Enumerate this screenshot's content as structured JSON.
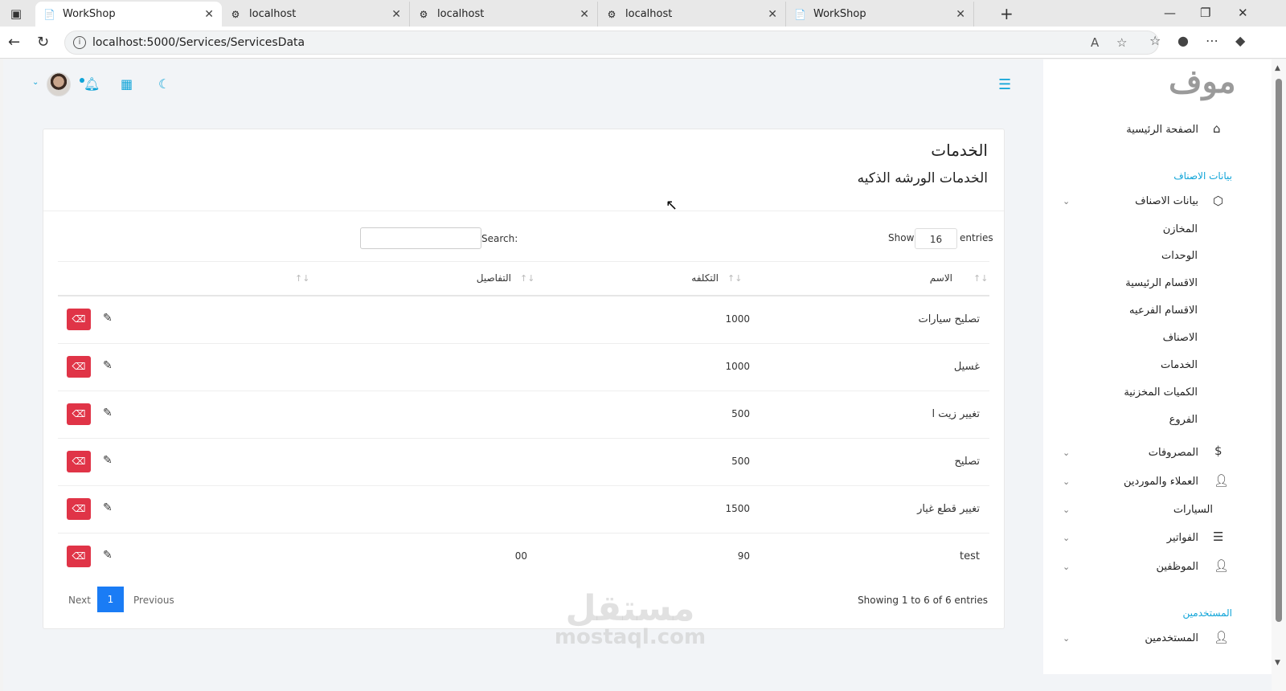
{
  "browser": {
    "tabs": [
      {
        "title": "WorkShop",
        "active": true
      },
      {
        "title": "localhost",
        "active": false
      },
      {
        "title": "localhost",
        "active": false
      },
      {
        "title": "localhost",
        "active": false
      },
      {
        "title": "WorkShop",
        "active": false
      }
    ],
    "url": "localhost:5000/Services/ServicesData"
  },
  "page": {
    "title": "الخدمات",
    "subtitle": "الخدمات الورشه الذكيه"
  },
  "table_controls": {
    "show_label": "Show",
    "entries_label": "entries",
    "page_length": "16",
    "search_label": "Search:"
  },
  "table": {
    "columns": [
      "الاسم",
      "التكلفه",
      "التفاصيل"
    ],
    "rows": [
      {
        "name": "تصليح سيارات",
        "cost": "1000",
        "details": ""
      },
      {
        "name": "غسيل",
        "cost": "1000",
        "details": ""
      },
      {
        "name": "تغيير زيت ا",
        "cost": "500",
        "details": ""
      },
      {
        "name": "تصليح",
        "cost": "500",
        "details": ""
      },
      {
        "name": "تغيير قطع غيار",
        "cost": "1500",
        "details": ""
      },
      {
        "name": "test",
        "cost": "90",
        "details": "00"
      }
    ]
  },
  "pagination": {
    "info": "Showing 1 to 6 of 6 entries",
    "next": "Next",
    "current": "1",
    "previous": "Previous"
  },
  "sidebar": {
    "logo": "موف",
    "home": "الصفحة الرئيسية",
    "heading_items": "بيانات الاصناف",
    "items_group": "بيانات الاصناف",
    "sub_items": [
      "المخازن",
      "الوحدات",
      "الاقسام الرئيسية",
      "الاقسام الفرعيه",
      "الاصناف",
      "الخدمات",
      "الكميات المخزنية",
      "الفروع"
    ],
    "expenses": "المصروفات",
    "clients_suppliers": "العملاء والموردين",
    "cars": "السيارات",
    "invoices": "الفواتير",
    "employees": "الموظفين",
    "heading_users": "المستخدمين",
    "users": "المستخدمين"
  },
  "watermark": {
    "arabic": "مستقل",
    "latin": "mostaql.com"
  },
  "colors": {
    "accent": "#0fa4d8",
    "danger": "#e03447",
    "primary": "#1a7cf5"
  }
}
